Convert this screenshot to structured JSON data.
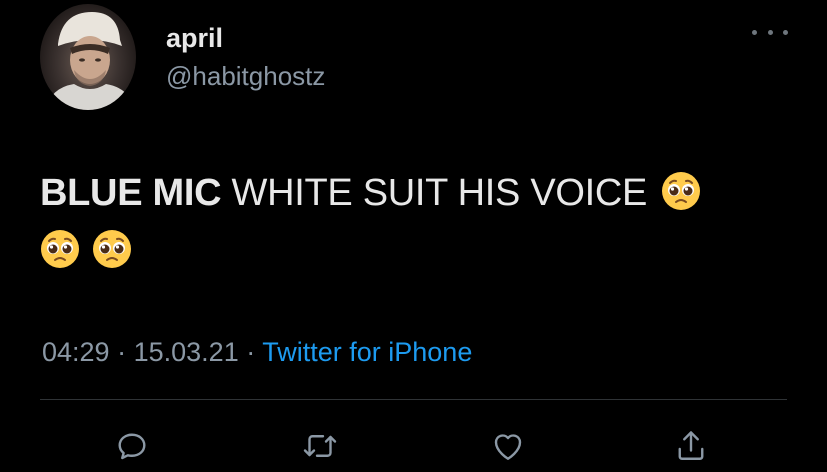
{
  "user": {
    "display_name": "april",
    "handle": "@habitghostz",
    "avatar_icon": "profile-photo"
  },
  "tweet": {
    "text_bold": "BLUE MIC",
    "text_regular": " WHITE SUIT HIS VOICE",
    "emoji": "pleading-face",
    "emoji_count": 3
  },
  "meta": {
    "time": "04:29",
    "separator": "·",
    "date": "15.03.21",
    "source": "Twitter for iPhone"
  },
  "actions": [
    {
      "name": "reply",
      "icon": "speech-bubble-icon"
    },
    {
      "name": "retweet",
      "icon": "retweet-icon"
    },
    {
      "name": "like",
      "icon": "heart-icon"
    },
    {
      "name": "share",
      "icon": "share-icon"
    }
  ],
  "colors": {
    "background": "#000000",
    "primary_text": "#e8e8e8",
    "secondary_text": "#8b98a5",
    "link": "#1d9bf0",
    "divider": "#2f3336"
  }
}
